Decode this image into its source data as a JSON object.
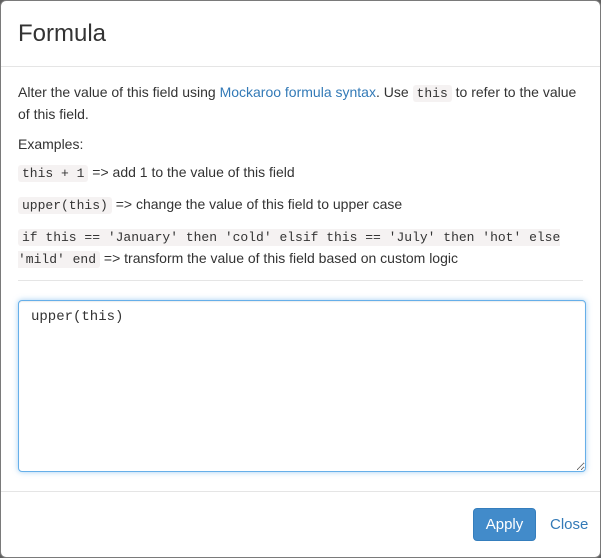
{
  "modal": {
    "title": "Formula"
  },
  "intro": {
    "text_before": "Alter the value of this field using ",
    "link_text": "Mockaroo formula syntax",
    "text_middle": ". Use ",
    "code": "this",
    "text_after": " to refer to the value of this field."
  },
  "examples": {
    "label": "Examples:",
    "items": [
      {
        "code": "this + 1",
        "description": " => add 1 to the value of this field"
      },
      {
        "code": "upper(this)",
        "description": " => change the value of this field to upper case"
      },
      {
        "code": "if this == 'January' then 'cold' elsif this == 'July' then 'hot' else 'mild' end",
        "description": " => transform the value of this field based on custom logic"
      }
    ]
  },
  "formula_input": {
    "value": "upper(this)"
  },
  "footer": {
    "apply_label": "Apply",
    "close_label": "Close"
  },
  "colors": {
    "primary": "#428bca",
    "link": "#337ab7",
    "focus_border": "#66afe9",
    "code_background": "#f5f2f2"
  }
}
